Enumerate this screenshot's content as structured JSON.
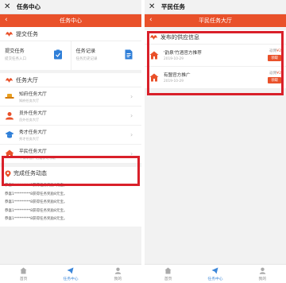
{
  "left": {
    "wx_title": "任务中心",
    "header_title": "任务中心",
    "submit": {
      "section_title": "提交任务",
      "cards": [
        {
          "title": "提交任务",
          "subtitle": "提交任务入口"
        },
        {
          "title": "任务记录",
          "subtitle": "任务历史记录"
        }
      ]
    },
    "hall": {
      "section_title": "任务大厅",
      "items": [
        {
          "name": "知府任务大厅",
          "subtitle": "知府任务大厅"
        },
        {
          "name": "员外任务大厅",
          "subtitle": "员外任务大厅"
        },
        {
          "name": "秀才任务大厅",
          "subtitle": "秀才任务大厅"
        },
        {
          "name": "平民任务大厅",
          "subtitle": "干得辛苦，活道获可领取"
        }
      ]
    },
    "done": {
      "section_title": "完成任务动态",
      "lines": [
        "恭喜1*********8获得任务奖励8元宝。",
        "恭喜1*********8获得任务奖励8元宝。",
        "恭喜1*********8获得任务奖励8元宝。",
        "恭喜1*********8获得任务奖励8元宝。",
        "恭喜1*********8获得任务奖励8元宝。"
      ]
    },
    "tabs": [
      {
        "label": "首页"
      },
      {
        "label": "任务中心"
      },
      {
        "label": "我的"
      }
    ]
  },
  "right": {
    "wx_title": "平民任务",
    "header_title": "平民任务大厅",
    "section_title": "发布的供应信息",
    "items": [
      {
        "name": "'韵泉'竹酒官方推荐",
        "date": "2019-10-29",
        "reward_label": "返佣",
        "reward_amount": "¥2",
        "button": "领取"
      },
      {
        "name": "有盟官方推广",
        "date": "2019-10-29",
        "reward_label": "返佣",
        "reward_amount": "¥2",
        "button": "领取"
      }
    ],
    "tabs": [
      {
        "label": "首页"
      },
      {
        "label": "任务中心"
      },
      {
        "label": "我的"
      }
    ]
  },
  "colors": {
    "accent": "#e9512a",
    "highlight": "#d9202a",
    "tab_active": "#3b86d9"
  }
}
